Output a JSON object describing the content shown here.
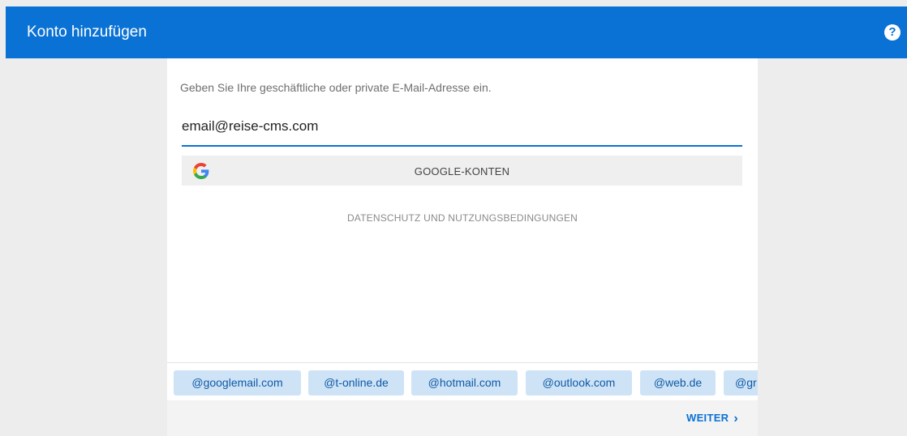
{
  "header": {
    "title": "Konto hinzufügen",
    "help_glyph": "?"
  },
  "form": {
    "prompt": "Geben Sie Ihre geschäftliche oder private E-Mail-Adresse ein.",
    "email_value": "email@reise-cms.com",
    "google_label": "GOOGLE-KONTEN",
    "privacy_link": "DATENSCHUTZ UND NUTZUNGSBEDINGUNGEN"
  },
  "suggestions": [
    "@googlemail.com",
    "@t-online.de",
    "@hotmail.com",
    "@outlook.com",
    "@web.de",
    "@gr"
  ],
  "footer": {
    "next_label": "WEITER",
    "next_chevron": "›"
  },
  "colors": {
    "accent": "#0a72d4",
    "chip_bg": "#cfe3f6",
    "chip_text": "#0e5aa7"
  }
}
